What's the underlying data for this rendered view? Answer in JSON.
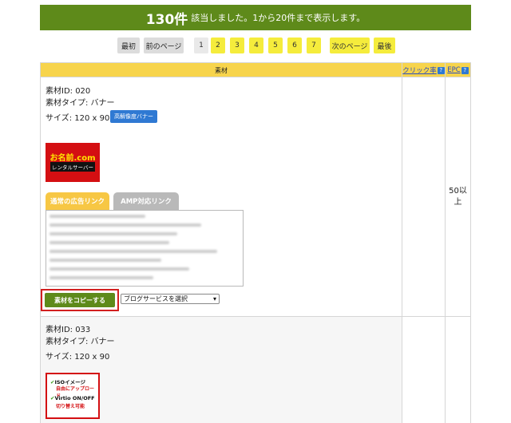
{
  "summary": {
    "count": "130件",
    "message": "該当しました。1から20件まで表示します。"
  },
  "pager": {
    "first": "最初",
    "prev": "前のページ",
    "pages": [
      "1",
      "2",
      "3",
      "4",
      "5",
      "6",
      "7"
    ],
    "current_page": "1",
    "next": "次のページ",
    "last": "最後"
  },
  "table": {
    "header_material": "素材",
    "header_click_rate": "クリック率",
    "header_epc": "EPC",
    "help_glyph": "?"
  },
  "rows": [
    {
      "id_line": "素材ID: 020",
      "type_line": "素材タイプ: バナー",
      "size_line": "サイズ: 120 x 90",
      "hi_res_badge": "高解像度バナー",
      "banner_text_main": "お名前.com",
      "banner_text_sub": "レンタルサーバー",
      "tab_normal": "通常の広告リンク",
      "tab_amp": "AMP対応リンク",
      "copy_button": "素材をコピーする",
      "blog_select": "ブログサービスを選択",
      "epc": "50以上"
    },
    {
      "id_line": "素材ID: 033",
      "type_line": "素材タイプ: バナー",
      "size_line": "サイズ: 120 x 90",
      "banner_line1": "ISOイメージ",
      "banner_line2": "自由にアップロード",
      "banner_line3": "Virtio ON/OFF",
      "banner_line4": "切り替え可能"
    }
  ],
  "colors": {
    "banner_green": "#5e8a1a",
    "header_yellow": "#f7d44c",
    "page_yellow": "#f5ec3c",
    "badge_blue": "#2f79d3",
    "highlight_red": "#d21f1f"
  }
}
